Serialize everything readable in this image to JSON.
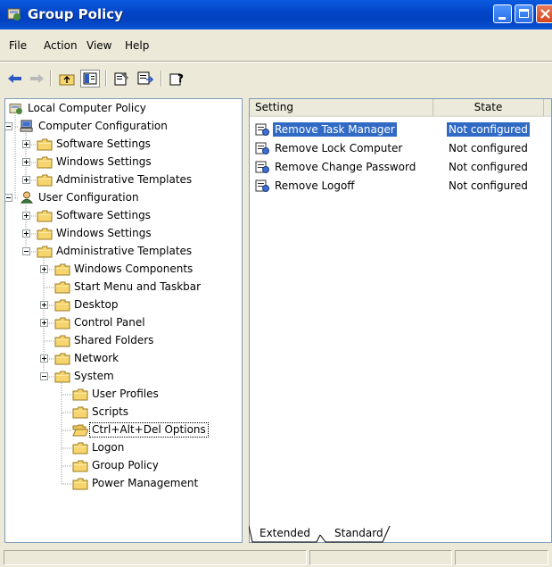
{
  "window": {
    "title": "Group Policy"
  },
  "menu": [
    "File",
    "Action",
    "View",
    "Help"
  ],
  "toolbar": {
    "tools": [
      "back-arrow-icon",
      "forward-arrow-icon",
      "up-folder-icon",
      "show-hide-tree-icon",
      "properties-icon",
      "export-list-icon",
      "help-icon"
    ]
  },
  "tree": {
    "nodes": [
      {
        "label": "Local Computer Policy"
      },
      {
        "label": "Computer Configuration"
      },
      {
        "label": "Software Settings"
      },
      {
        "label": "Windows Settings"
      },
      {
        "label": "Administrative Templates"
      },
      {
        "label": "User Configuration"
      },
      {
        "label": "Software Settings"
      },
      {
        "label": "Windows Settings"
      },
      {
        "label": "Administrative Templates"
      },
      {
        "label": "Windows Components"
      },
      {
        "label": "Start Menu and Taskbar"
      },
      {
        "label": "Desktop"
      },
      {
        "label": "Control Panel"
      },
      {
        "label": "Shared Folders"
      },
      {
        "label": "Network"
      },
      {
        "label": "System"
      },
      {
        "label": "User Profiles"
      },
      {
        "label": "Scripts"
      },
      {
        "label": "Ctrl+Alt+Del Options"
      },
      {
        "label": "Logon"
      },
      {
        "label": "Group Policy"
      },
      {
        "label": "Power Management"
      }
    ]
  },
  "list": {
    "columns": [
      "Setting",
      "State"
    ],
    "rows": [
      {
        "setting": "Remove Task Manager",
        "state": "Not configured"
      },
      {
        "setting": "Remove Lock Computer",
        "state": "Not configured"
      },
      {
        "setting": "Remove Change Password",
        "state": "Not configured"
      },
      {
        "setting": "Remove Logoff",
        "state": "Not configured"
      }
    ]
  },
  "tabs": [
    "Extended",
    "Standard"
  ],
  "colors": {
    "selection": "#316ac5",
    "titlebar": "#0042c0",
    "folder": "#f7d56e"
  }
}
